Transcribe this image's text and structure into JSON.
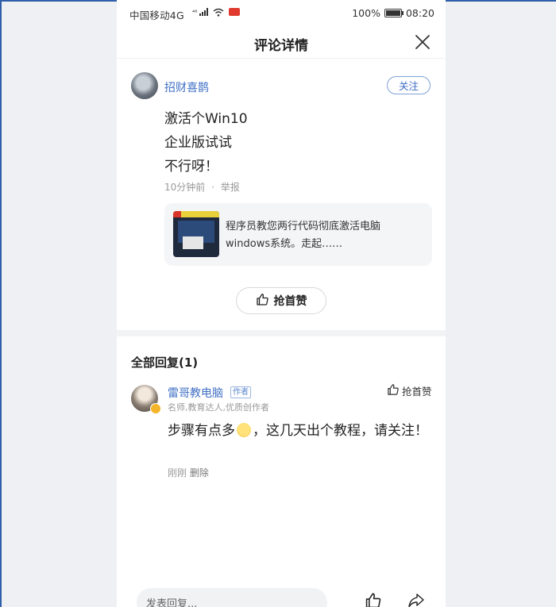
{
  "status_bar": {
    "carrier": "中国移动4G",
    "network_badge": "⁴⁶",
    "battery": "100%",
    "battery_level": 1.0,
    "time": "08:20"
  },
  "header": {
    "title": "评论详情",
    "close_icon": "close-icon"
  },
  "comment": {
    "username": "招财喜鹊",
    "follow_label": "关注",
    "lines": [
      "激活个Win10",
      "企业版试试",
      "不行呀！"
    ],
    "time": "10分钟前",
    "separator": "·",
    "report_label": "举报",
    "article_card": {
      "text": "程序员教您两行代码彻底激活电脑windows系统。走起……"
    },
    "like_first_label": "抢首赞"
  },
  "replies": {
    "title": "全部回复(1)",
    "items": [
      {
        "username": "雷哥教电脑",
        "author_tag": "作者",
        "description": "名师,教育达人,优质创作者",
        "like_label": "抢首赞",
        "text_before_emoji": "步骤有点多",
        "text_after_emoji": "，这几天出个教程，请关注！",
        "time": "刚刚",
        "delete_label": "删除"
      }
    ]
  },
  "bottom_bar": {
    "reply_placeholder": "发表回复..."
  },
  "colors": {
    "link_blue": "#3f6fc4",
    "background": "#ffffff",
    "outer_background": "#eef0f4"
  }
}
